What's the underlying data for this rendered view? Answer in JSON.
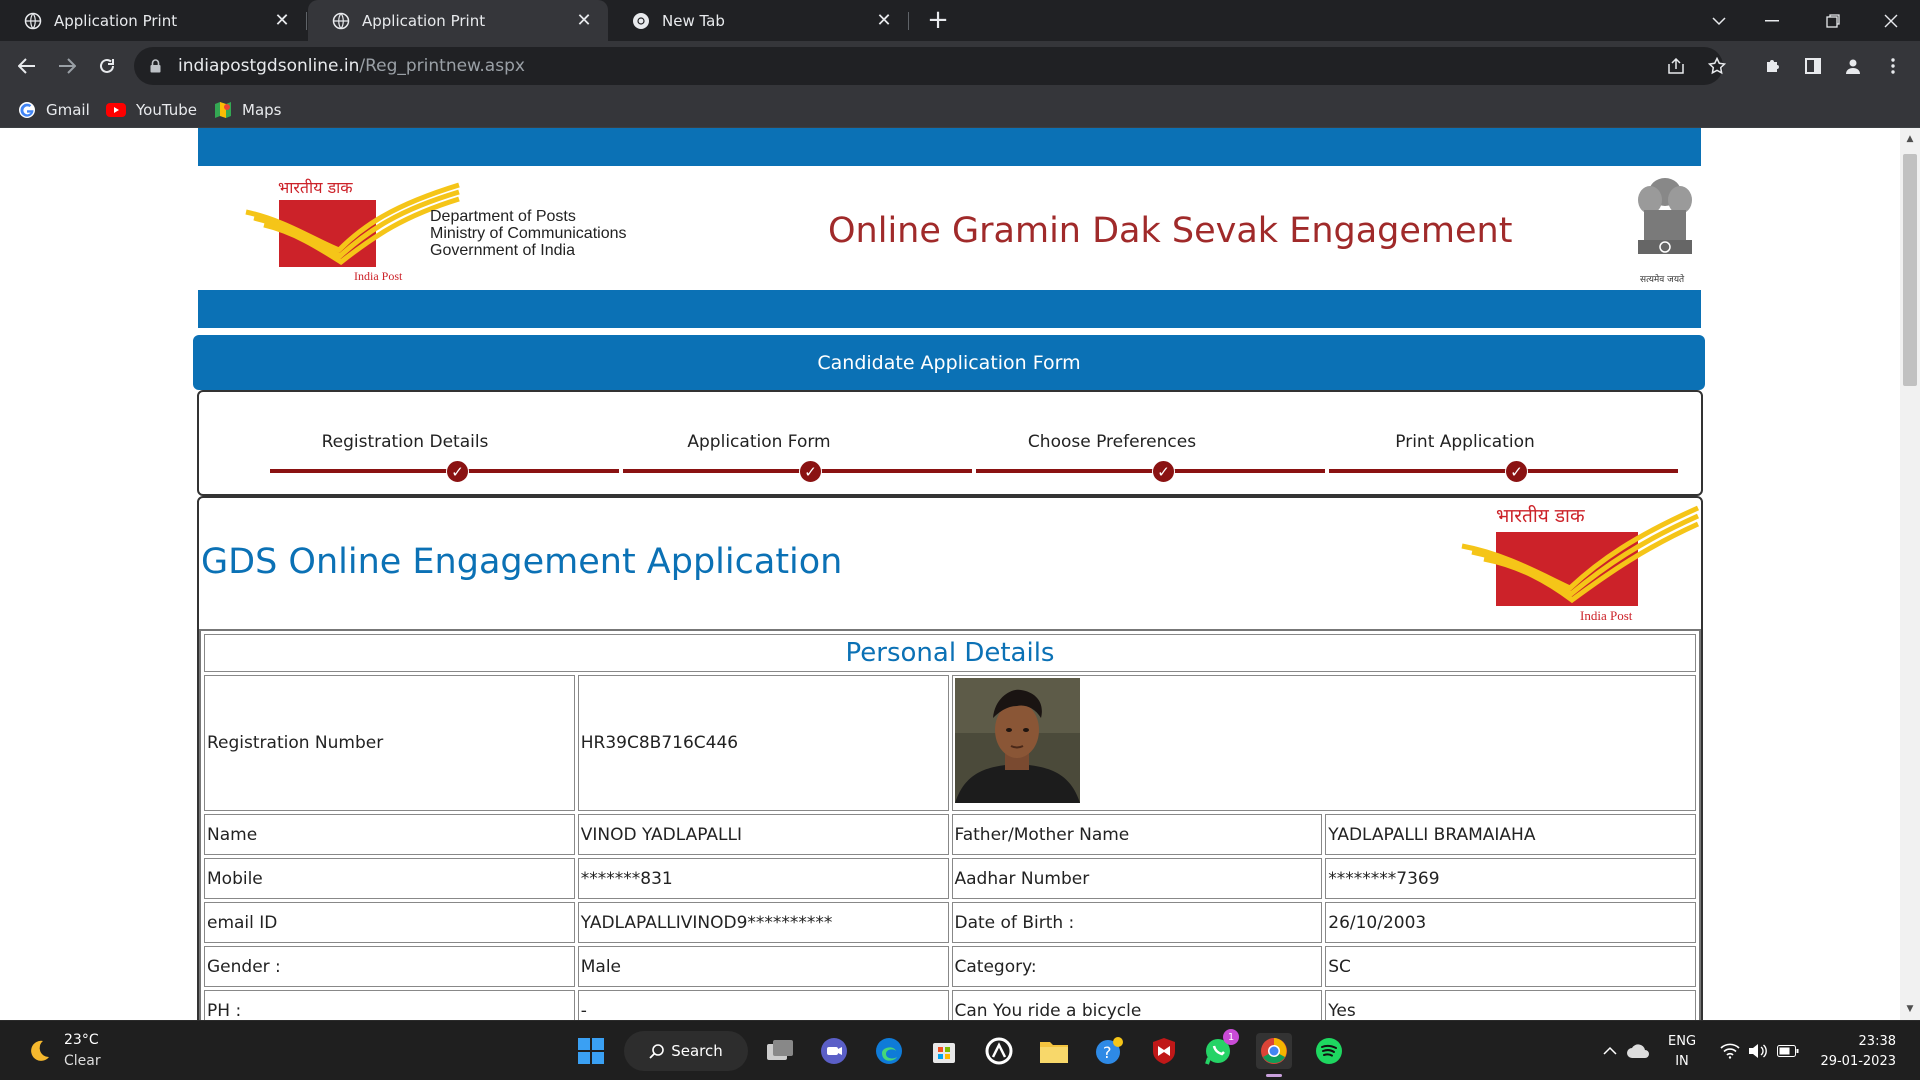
{
  "browser": {
    "tabs": [
      {
        "title": "Application Print"
      },
      {
        "title": "Application Print"
      },
      {
        "title": "New Tab"
      }
    ],
    "url_domain": "indiapostgdsonline.in",
    "url_path": "/Reg_printnew.aspx",
    "bookmarks": [
      {
        "label": "Gmail"
      },
      {
        "label": "YouTube"
      },
      {
        "label": "Maps"
      }
    ]
  },
  "header": {
    "logo_hindi": "भारतीय डाक",
    "logo_caption": "India Post",
    "dept_line1": "Department of Posts",
    "dept_line2": "Ministry of Communications",
    "dept_line3": "Government of India",
    "site_title": "Online Gramin Dak Sevak Engagement",
    "emblem_caption": "सत्यमेव जयते"
  },
  "form_banner": "Candidate Application Form",
  "steps": [
    {
      "label": "Registration Details",
      "done": true
    },
    {
      "label": "Application Form",
      "done": true
    },
    {
      "label": "Choose Preferences",
      "done": true
    },
    {
      "label": "Print Application",
      "done": true
    }
  ],
  "application": {
    "title": "GDS Online Engagement Application",
    "logo_hindi": "भारतीय डाक",
    "logo_caption": "India Post",
    "section_title": "Personal Details",
    "registration": {
      "label": "Registration Number",
      "value": "HR39C8B716C446"
    },
    "rows": [
      {
        "l1": "Name",
        "v1": "VINOD YADLAPALLI",
        "l2": "Father/Mother Name",
        "v2": "YADLAPALLI BRAMAIAHA"
      },
      {
        "l1": "Mobile",
        "v1": "*******831",
        "l2": "Aadhar Number",
        "v2": "********7369"
      },
      {
        "l1": "email ID",
        "v1": "YADLAPALLIVINOD9**********",
        "l2": "Date of Birth :",
        "v2": "26/10/2003"
      },
      {
        "l1": "Gender :",
        "v1": "Male",
        "l2": "Category:",
        "v2": "SC"
      },
      {
        "l1": "PH :",
        "v1": "-",
        "l2": "Can You ride a bicycle",
        "v2": "Yes"
      }
    ]
  },
  "taskbar": {
    "temperature": "23°C",
    "condition": "Clear",
    "search_label": "Search",
    "whatsapp_badge": "1",
    "lang_line1": "ENG",
    "lang_line2": "IN",
    "time": "23:38",
    "date": "29-01-2023"
  },
  "colors": {
    "brand_blue": "#0b71b5",
    "title_red": "#a02a2a",
    "step_maroon": "#8a1212",
    "post_red": "#cc2229",
    "post_yellow": "#f5c518"
  }
}
